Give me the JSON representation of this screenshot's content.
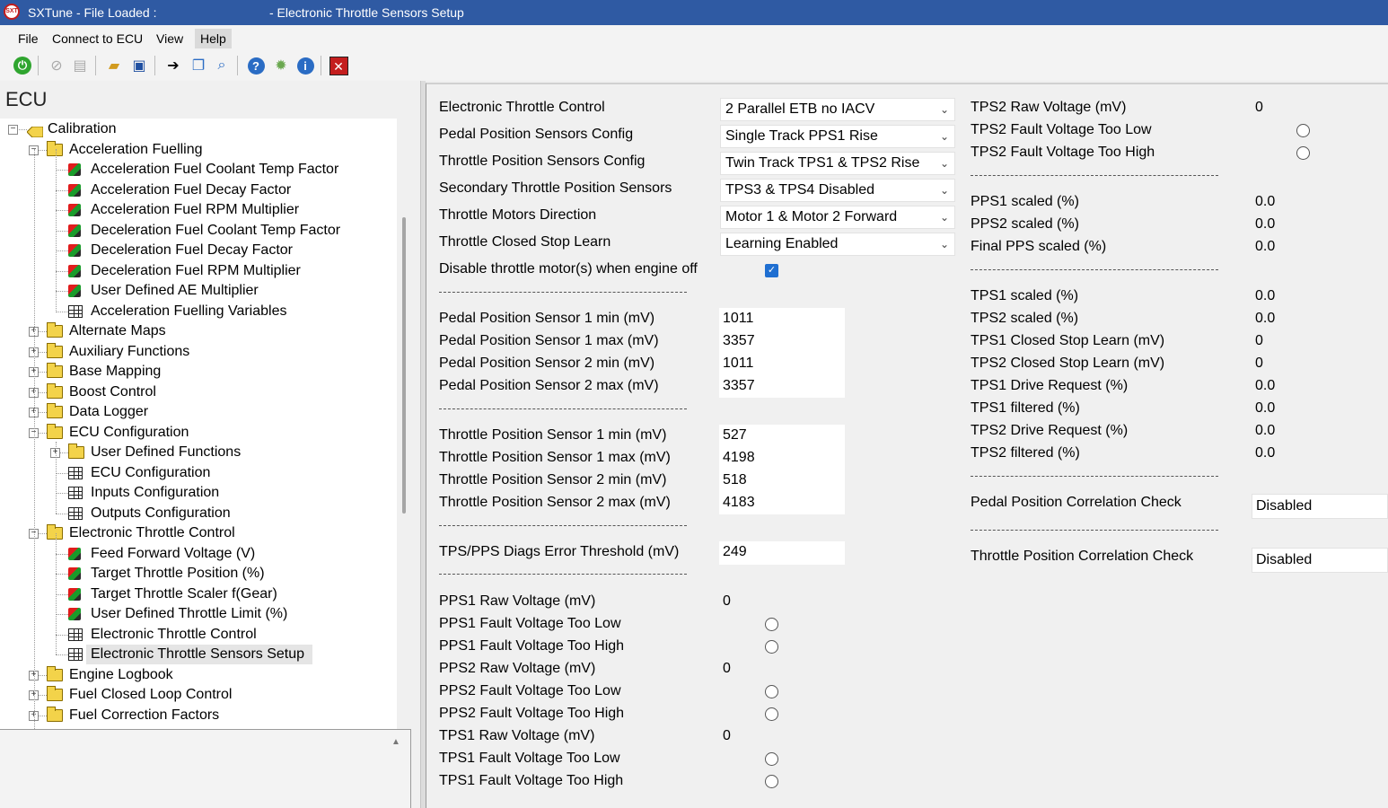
{
  "window": {
    "title_left": "SXTune - File Loaded :",
    "title_right": "- Electronic Throttle Sensors Setup",
    "app_icon_text": "SXT"
  },
  "menu": [
    "File",
    "Connect to ECU",
    "View",
    "Help"
  ],
  "toolbar_icons": [
    "power-icon",
    "disconnect-icon",
    "chart-icon",
    "open-folder-icon",
    "save-icon",
    "goto-icon",
    "copy-icon",
    "search-icon",
    "help-icon",
    "settings-icon",
    "info-icon",
    "close-icon"
  ],
  "left": {
    "header": "ECU",
    "tree": [
      {
        "label": "Calibration",
        "icon": "calibration",
        "level": 0
      },
      {
        "label": "Acceleration Fuelling",
        "icon": "folder",
        "level": 1
      },
      {
        "label": "Acceleration Fuel Coolant Temp Factor",
        "icon": "cube",
        "level": 2
      },
      {
        "label": "Acceleration Fuel Decay Factor",
        "icon": "cube",
        "level": 2
      },
      {
        "label": "Acceleration Fuel RPM Multiplier",
        "icon": "cube",
        "level": 2
      },
      {
        "label": "Deceleration Fuel Coolant Temp Factor",
        "icon": "cube",
        "level": 2
      },
      {
        "label": "Deceleration Fuel Decay Factor",
        "icon": "cube",
        "level": 2
      },
      {
        "label": "Deceleration Fuel RPM Multiplier",
        "icon": "cube",
        "level": 2
      },
      {
        "label": "User Defined AE Multiplier",
        "icon": "cube",
        "level": 2
      },
      {
        "label": "Acceleration Fuelling Variables",
        "icon": "table",
        "level": 2
      },
      {
        "label": "Alternate Maps",
        "icon": "folder",
        "level": 1
      },
      {
        "label": "Auxiliary Functions",
        "icon": "folder",
        "level": 1
      },
      {
        "label": "Base Mapping",
        "icon": "folder",
        "level": 1
      },
      {
        "label": "Boost Control",
        "icon": "folder",
        "level": 1
      },
      {
        "label": "Data Logger",
        "icon": "folder",
        "level": 1
      },
      {
        "label": "ECU Configuration",
        "icon": "folder",
        "level": 1
      },
      {
        "label": "User Defined Functions",
        "icon": "folder",
        "level": 2
      },
      {
        "label": "ECU Configuration",
        "icon": "table",
        "level": 2
      },
      {
        "label": "Inputs Configuration",
        "icon": "table",
        "level": 2
      },
      {
        "label": "Outputs Configuration",
        "icon": "table",
        "level": 2
      },
      {
        "label": "Electronic Throttle Control",
        "icon": "folder",
        "level": 1
      },
      {
        "label": "Feed Forward Voltage (V)",
        "icon": "cube",
        "level": 2
      },
      {
        "label": "Target Throttle Position (%)",
        "icon": "cube",
        "level": 2
      },
      {
        "label": "Target Throttle Scaler f(Gear)",
        "icon": "cube",
        "level": 2
      },
      {
        "label": "User Defined Throttle Limit (%)",
        "icon": "cube",
        "level": 2
      },
      {
        "label": "Electronic Throttle Control",
        "icon": "table",
        "level": 2
      },
      {
        "label": "Electronic Throttle Sensors Setup",
        "icon": "table",
        "level": 2
      },
      {
        "label": "Engine Logbook",
        "icon": "folder",
        "level": 1
      },
      {
        "label": "Fuel Closed Loop Control",
        "icon": "folder",
        "level": 1
      },
      {
        "label": "Fuel Correction Factors",
        "icon": "folder",
        "level": 1
      }
    ]
  },
  "col1": {
    "config_rows": [
      {
        "label": "Electronic Throttle Control",
        "value": "2 Parallel ETB no IACV"
      },
      {
        "label": "Pedal Position Sensors Config",
        "value": "Single Track PPS1 Rise"
      },
      {
        "label": "Throttle Position Sensors Config",
        "value": "Twin Track TPS1 & TPS2 Rise"
      },
      {
        "label": "Secondary Throttle Position Sensors",
        "value": "TPS3 & TPS4 Disabled"
      },
      {
        "label": "Throttle Motors Direction",
        "value": "Motor 1 & Motor 2 Forward"
      },
      {
        "label": "Throttle Closed Stop Learn",
        "value": "Learning Enabled"
      }
    ],
    "disable_motor_label": "Disable throttle motor(s) when engine off",
    "disable_motor_checked": true,
    "pps_limits": [
      {
        "label": "Pedal Position Sensor 1 min (mV)",
        "value": "1011"
      },
      {
        "label": "Pedal Position Sensor 1 max (mV)",
        "value": "3357"
      },
      {
        "label": "Pedal Position Sensor 2 min (mV)",
        "value": "1011"
      },
      {
        "label": "Pedal Position Sensor 2 max (mV)",
        "value": "3357"
      }
    ],
    "tps_limits": [
      {
        "label": "Throttle Position Sensor 1 min (mV)",
        "value": "527"
      },
      {
        "label": "Throttle Position Sensor 1 max (mV)",
        "value": "4198"
      },
      {
        "label": "Throttle Position Sensor 2 min (mV)",
        "value": "518"
      },
      {
        "label": "Throttle Position Sensor 2 max (mV)",
        "value": "4183"
      }
    ],
    "diag_threshold": {
      "label": "TPS/PPS Diags Error Threshold (mV)",
      "value": "249"
    },
    "status_rows": [
      {
        "label": "PPS1 Raw Voltage (mV)",
        "value": "0"
      },
      {
        "label": "PPS1 Fault Voltage Too Low",
        "radio": true
      },
      {
        "label": "PPS1 Fault Voltage Too High",
        "radio": true
      },
      {
        "label": "PPS2 Raw Voltage (mV)",
        "value": "0"
      },
      {
        "label": "PPS2 Fault Voltage Too Low",
        "radio": true
      },
      {
        "label": "PPS2 Fault Voltage Too High",
        "radio": true
      },
      {
        "label": "TPS1 Raw Voltage (mV)",
        "value": "0"
      },
      {
        "label": "TPS1 Fault Voltage Too Low",
        "radio": true
      },
      {
        "label": "TPS1 Fault Voltage Too High",
        "radio": true
      }
    ]
  },
  "col2": {
    "group1": [
      {
        "label": "TPS2 Raw Voltage (mV)",
        "value": "0"
      },
      {
        "label": "TPS2 Fault Voltage Too Low",
        "radio": true
      },
      {
        "label": "TPS2 Fault Voltage Too High",
        "radio": true
      }
    ],
    "group2": [
      {
        "label": "PPS1 scaled (%)",
        "value": "0.0"
      },
      {
        "label": "PPS2 scaled (%)",
        "value": "0.0"
      },
      {
        "label": "Final PPS scaled (%)",
        "value": "0.0"
      }
    ],
    "group3": [
      {
        "label": "TPS1 scaled (%)",
        "value": "0.0"
      },
      {
        "label": "TPS2 scaled (%)",
        "value": "0.0"
      },
      {
        "label": "TPS1 Closed Stop Learn (mV)",
        "value": "0"
      },
      {
        "label": "TPS2 Closed Stop Learn (mV)",
        "value": "0"
      },
      {
        "label": "TPS1 Drive Request (%)",
        "value": "0.0"
      },
      {
        "label": "TPS1 filtered (%)",
        "value": "0.0"
      },
      {
        "label": "TPS2 Drive Request (%)",
        "value": "0.0"
      },
      {
        "label": "TPS2 filtered (%)",
        "value": "0.0"
      }
    ],
    "pedal_corr": {
      "label": "Pedal Position Correlation Check",
      "value": "Disabled"
    },
    "throttle_corr": {
      "label": "Throttle Position Correlation Check",
      "value": "Disabled"
    }
  },
  "separator_text": "--------------------------------------------------------------------"
}
